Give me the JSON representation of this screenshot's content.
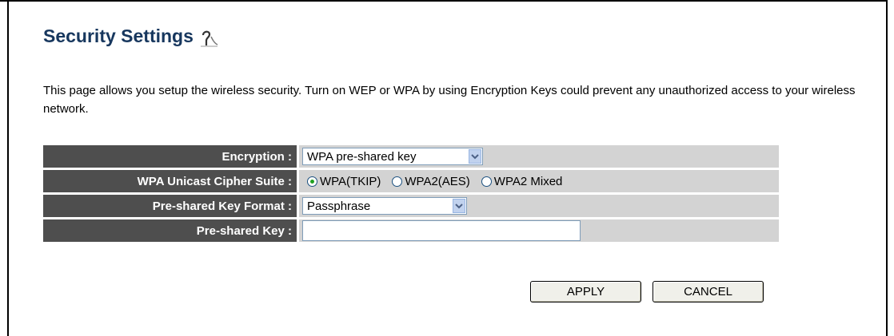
{
  "page": {
    "title": "Security Settings",
    "description": "This page allows you setup the wireless security. Turn on WEP or WPA by using Encryption Keys could prevent any unauthorized access to your wireless network."
  },
  "form": {
    "encryption": {
      "label": "Encryption :",
      "value": "WPA pre-shared key"
    },
    "cipher": {
      "label": "WPA Unicast Cipher Suite :",
      "options": [
        "WPA(TKIP)",
        "WPA2(AES)",
        "WPA2 Mixed"
      ],
      "selected": "WPA(TKIP)"
    },
    "key_format": {
      "label": "Pre-shared Key Format :",
      "value": "Passphrase"
    },
    "key": {
      "label": "Pre-shared Key :",
      "value": ""
    }
  },
  "buttons": {
    "apply": "APPLY",
    "cancel": "CANCEL"
  },
  "colors": {
    "title": "#17375e",
    "label_bg": "#4e4e4e",
    "value_bg": "#d3d3d3"
  }
}
